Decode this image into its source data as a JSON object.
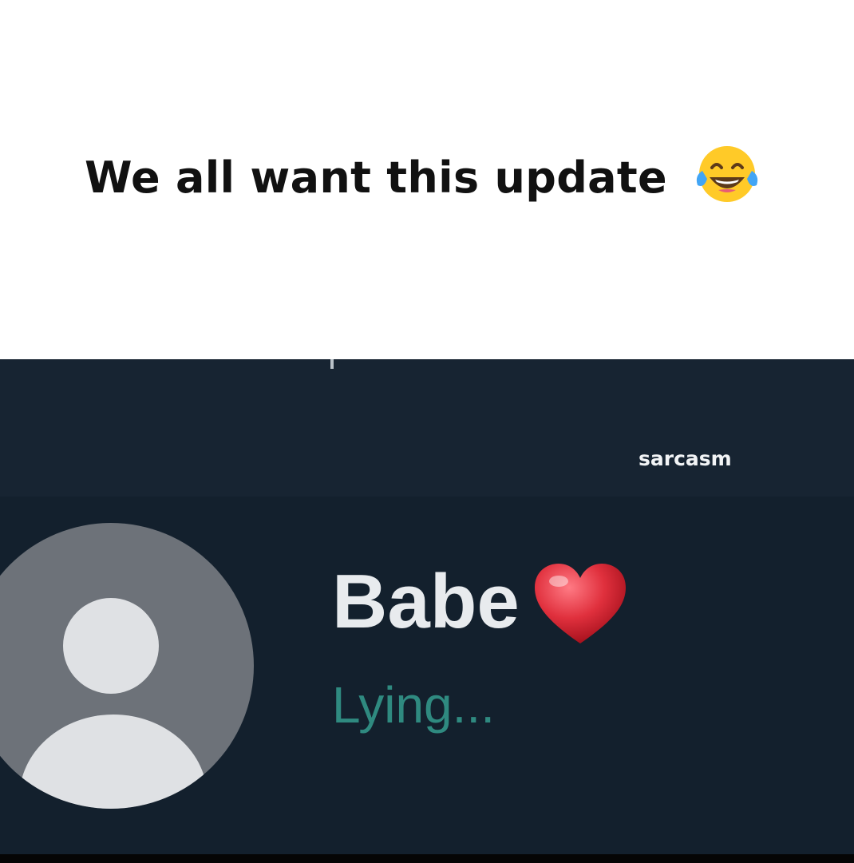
{
  "caption": {
    "text": "We all want this update",
    "emoji": "face-with-tears-of-joy-icon"
  },
  "chat_header": {
    "watermark": "sarcasm"
  },
  "profile": {
    "contact_name": "Babe",
    "name_emoji": "red-heart-icon",
    "status": "Lying..."
  },
  "colors": {
    "caption_background": "#ffffff",
    "screen_background": "#152330",
    "avatar_background": "#6d7279",
    "avatar_silhouette": "#dfe1e4",
    "name_color": "#e8ebee",
    "status_color": "#2f8a80",
    "heart_color": "#e0303d"
  }
}
